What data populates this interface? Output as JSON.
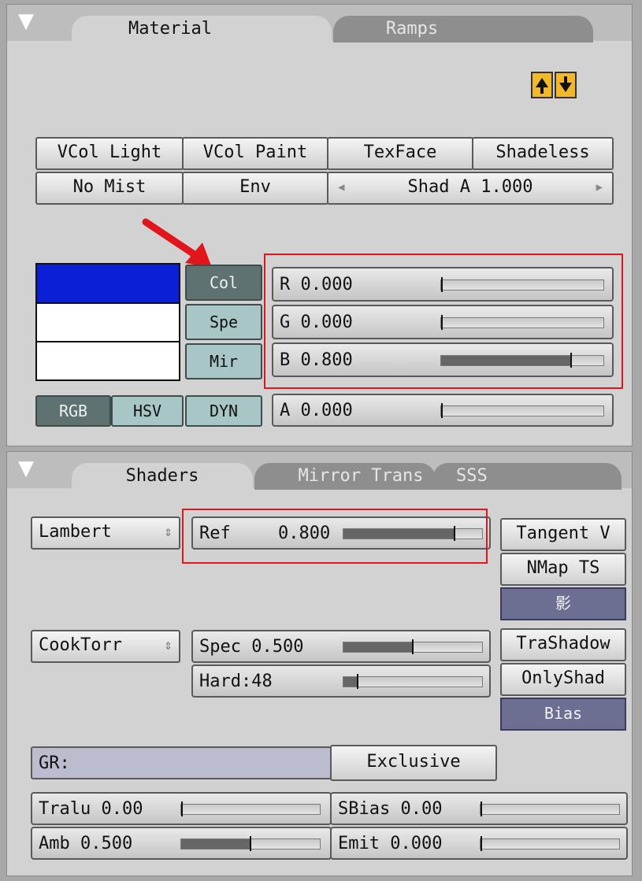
{
  "material_panel": {
    "tabs": {
      "active": "Material",
      "inactive": "Ramps"
    },
    "icons": [
      "move-up-icon",
      "move-down-icon"
    ],
    "row1": [
      "VCol Light",
      "VCol Paint",
      "TexFace",
      "Shadeless"
    ],
    "row2": {
      "no_mist": "No Mist",
      "env": "Env",
      "shad_a": "Shad A 1.000"
    },
    "swatches": [
      "#0a1fd6",
      "#ffffff",
      "#ffffff"
    ],
    "color_buttons": {
      "col": "Col",
      "spe": "Spe",
      "mir": "Mir"
    },
    "sliders": {
      "r": {
        "label": "R 0.000",
        "value": 0.0
      },
      "g": {
        "label": "G 0.000",
        "value": 0.0
      },
      "b": {
        "label": "B 0.800",
        "value": 0.8
      },
      "a": {
        "label": "A 0.000",
        "value": 0.0
      }
    },
    "modes": {
      "rgb": "RGB",
      "hsv": "HSV",
      "dyn": "DYN"
    }
  },
  "shaders_panel": {
    "tabs": {
      "active": "Shaders",
      "mirror_trans": "Mirror Trans",
      "sss": "SSS"
    },
    "diffuse": {
      "shader": "Lambert",
      "ref_label": "Ref",
      "ref_value": "0.800",
      "ref_amount": 0.8
    },
    "specular": {
      "shader": "CookTorr",
      "spec": {
        "label": "Spec 0.500",
        "value": 0.5
      },
      "hard": {
        "label": "Hard:48",
        "value": 0.1
      }
    },
    "right_buttons": [
      "Tangent V",
      "NMap TS",
      "影",
      "TraShadow",
      "OnlyShad",
      "Bias"
    ],
    "gr_label": "GR:",
    "exclusive": "Exclusive",
    "bottom": {
      "tralu": {
        "label": "Tralu 0.00",
        "value": 0.0
      },
      "sbias": {
        "label": "SBias 0.00",
        "value": 0.0
      },
      "amb": {
        "label": "Amb 0.500",
        "value": 0.5
      },
      "emit": {
        "label": "Emit 0.000",
        "value": 0.0
      }
    }
  },
  "colors": {
    "highlight": "#e0161c",
    "dark_button": "#6d6f92",
    "col_active": "#5e7272"
  }
}
